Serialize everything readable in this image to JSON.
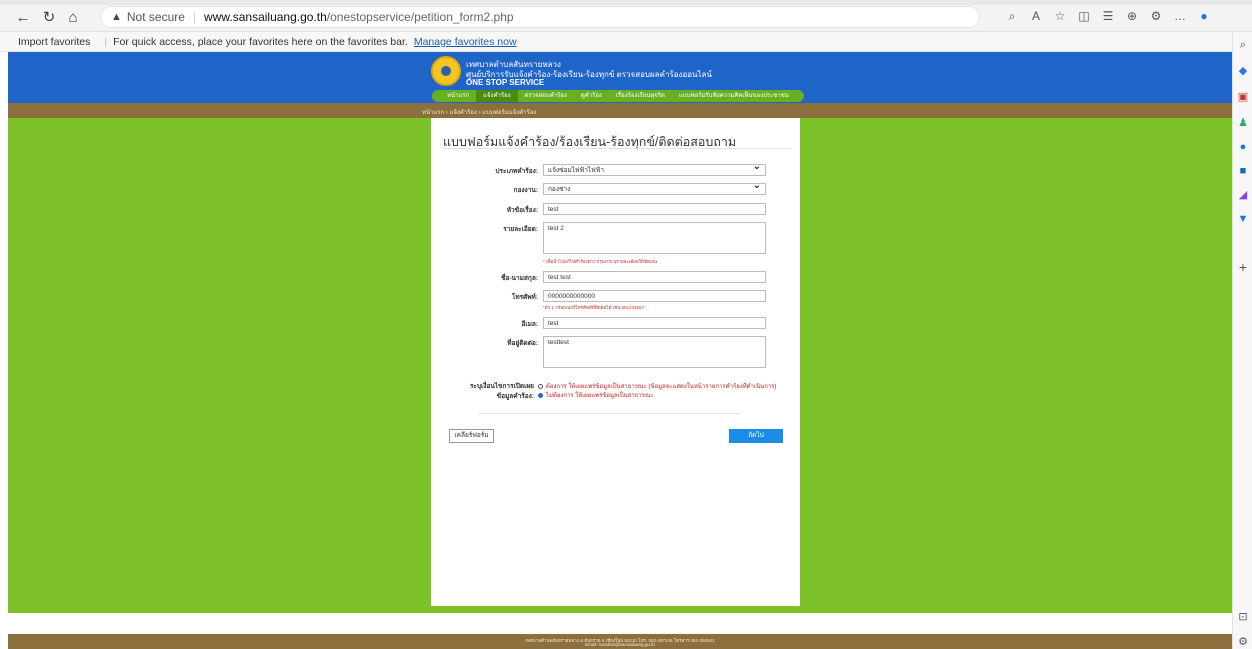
{
  "browser": {
    "address_warning": "Not secure",
    "url_host": "www.sansailuang.go.th",
    "url_path": "/onestopservice/petition_form2.php"
  },
  "favorites": {
    "import": "Import favorites",
    "hint": "For quick access, place your favorites here on the favorites bar.",
    "manage": "Manage favorites now"
  },
  "header": {
    "org_name": "เทศบาลตำบลสันทรายหลวง",
    "center_name": "ศูนย์บริการรับแจ้งคำร้อง-ร้องเรียน-ร้องทุกข์ ตรวจสอบผลคำร้องออนไลน์",
    "service": "ONE STOP SERVICE",
    "nav": [
      "หน้าแรก",
      "แจ้งคำร้อง",
      "ตรวจสอบคำร้อง",
      "ดูคำร้อง",
      "เรื่องร้องเรียนทุจริต",
      "แบบฟอร์มรับฟังความคิดเห็นของประชาชน"
    ],
    "breadcrumb": "หน้าแรก › แจ้งคำร้อง › แบบฟอร์มแจ้งคำร้อง"
  },
  "form": {
    "title": "แบบฟอร์มแจ้งคำร้อง/ร้องเรียน-ร้องทุกข์/ติดต่อสอบถาม",
    "type_label": "ประเภทคำร้อง:",
    "type_value": "แจ้งซ่อมไฟฟ้าไฟฟ้า",
    "division_label": "กองงาน:",
    "division_value": "กองช่าง",
    "subject_label": "หัวข้อเรื่อง:",
    "subject_value": "test",
    "detail_label": "รายละเอียด:",
    "detail_value": "test 2",
    "detail_note": "* เพื่อนำไปแก้ไขคำร้องต่าง กรุณาระบุรายละเอียดให้ชัดเจน",
    "name_label": "ชื่อ-นามสกุล:",
    "name_value": "test test",
    "phone_label": "โทรศัพท์:",
    "phone_value": "0000000000000",
    "phone_note": "*ตัว 1 กรอกเบอร์โทรศัพท์ที่ติดต่อได้ เช่น 081234567",
    "email_label": "อีเมล:",
    "email_value": "test",
    "address_label": "ที่อยู่ติดต่อ:",
    "address_value": "testtest",
    "publish_label": "ระบุเงื่อนไขการเปิดเผยข้อมูลคำร้อง:",
    "publish_opt1": "ต้องการ ให้เผยแพร่ข้อมูลเป็นสาธารณะ (ข้อมูลจะแสดงในหน้ารายการคำร้องที่ดำเนินการ)",
    "publish_opt2": "ไม่ต้องการ ให้เผยแพร่ข้อมูลเป็นสาธารณะ",
    "clear_button": "เคลียร์ฟอร์ม",
    "next_button": "ถัดไป"
  },
  "footer": {
    "line1": "เทศบาลตำบลสันทรายหลวง อ.สันทราย จ.เชียงใหม่ 50210 โทร. 053-497245 โทรสาร 053-350921",
    "line2": "Email: saraban@sansailuang.go.th"
  },
  "colors": {
    "page_green": "#7ec22a",
    "header_blue": "#1f64c8",
    "brown_bar": "#8b6f3c",
    "next_blue": "#1a8ce6"
  }
}
